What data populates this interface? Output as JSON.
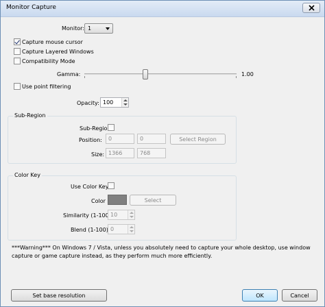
{
  "window": {
    "title": "Monitor Capture"
  },
  "monitor": {
    "label": "Monitor:",
    "value": "1"
  },
  "checkboxes": {
    "capture_mouse": {
      "label": "Capture mouse cursor",
      "checked": true
    },
    "capture_layered": {
      "label": "Capture Layered Windows",
      "checked": false
    },
    "compat_mode": {
      "label": "Compatibility Mode",
      "checked": false
    },
    "point_filtering": {
      "label": "Use point filtering",
      "checked": false
    }
  },
  "gamma": {
    "label": "Gamma:",
    "value": "1.00",
    "fraction": 0.4
  },
  "opacity": {
    "label": "Opacity:",
    "value": "100"
  },
  "subregion": {
    "group_title": "Sub-Region",
    "toggle_label": "Sub-Region",
    "checked": false,
    "position_label": "Position:",
    "position_x": "0",
    "position_y": "0",
    "select_button": "Select Region",
    "size_label": "Size:",
    "size_w": "1366",
    "size_h": "768"
  },
  "colorkey": {
    "group_title": "Color Key",
    "use_label": "Use Color Key:",
    "checked": false,
    "color_label": "Color",
    "color_value": "#808080",
    "select_button": "Select",
    "similarity_label": "Similarity (1-100):",
    "similarity_value": "10",
    "blend_label": "Blend (1-100):",
    "blend_value": "0"
  },
  "warning_text": "***Warning*** On Windows 7 / Vista, unless you absolutely need to capture your whole desktop, use window capture or game capture instead, as they perform much more efficiently.",
  "footer": {
    "base_resolution_button": "Set base resolution",
    "ok_button": "OK",
    "cancel_button": "Cancel"
  }
}
